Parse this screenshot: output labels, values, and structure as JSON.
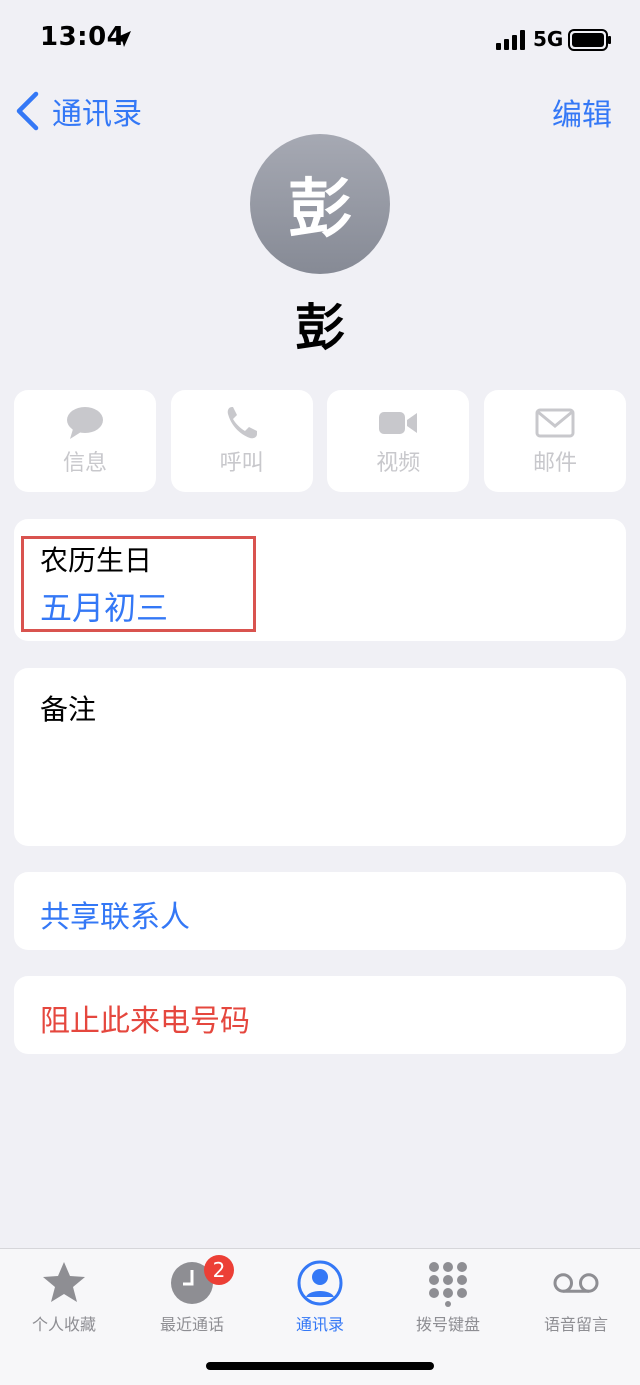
{
  "status_bar": {
    "time": "13:04",
    "network": "5G"
  },
  "nav": {
    "back_label": "通讯录",
    "edit_label": "编辑"
  },
  "contact": {
    "avatar_initial": "彭",
    "name": "彭"
  },
  "actions": [
    {
      "label": "信息",
      "icon": "message-icon"
    },
    {
      "label": "呼叫",
      "icon": "phone-icon"
    },
    {
      "label": "视频",
      "icon": "video-icon"
    },
    {
      "label": "邮件",
      "icon": "mail-icon"
    }
  ],
  "birthday": {
    "label": "农历生日",
    "value": "五月初三"
  },
  "notes": {
    "label": "备注"
  },
  "share": {
    "label": "共享联系人"
  },
  "block": {
    "label": "阻止此来电号码"
  },
  "tab_bar": {
    "tabs": [
      {
        "label": "个人收藏",
        "icon": "star-icon"
      },
      {
        "label": "最近通话",
        "icon": "clock-icon",
        "badge": "2"
      },
      {
        "label": "通讯录",
        "icon": "person-circle-icon",
        "active": true
      },
      {
        "label": "拨号键盘",
        "icon": "keypad-icon"
      },
      {
        "label": "语音留言",
        "icon": "voicemail-icon"
      }
    ]
  },
  "colors": {
    "accent": "#3478f6",
    "destructive": "#e5473e",
    "highlight_box": "#d9534f",
    "badge": "#ec3f36"
  }
}
